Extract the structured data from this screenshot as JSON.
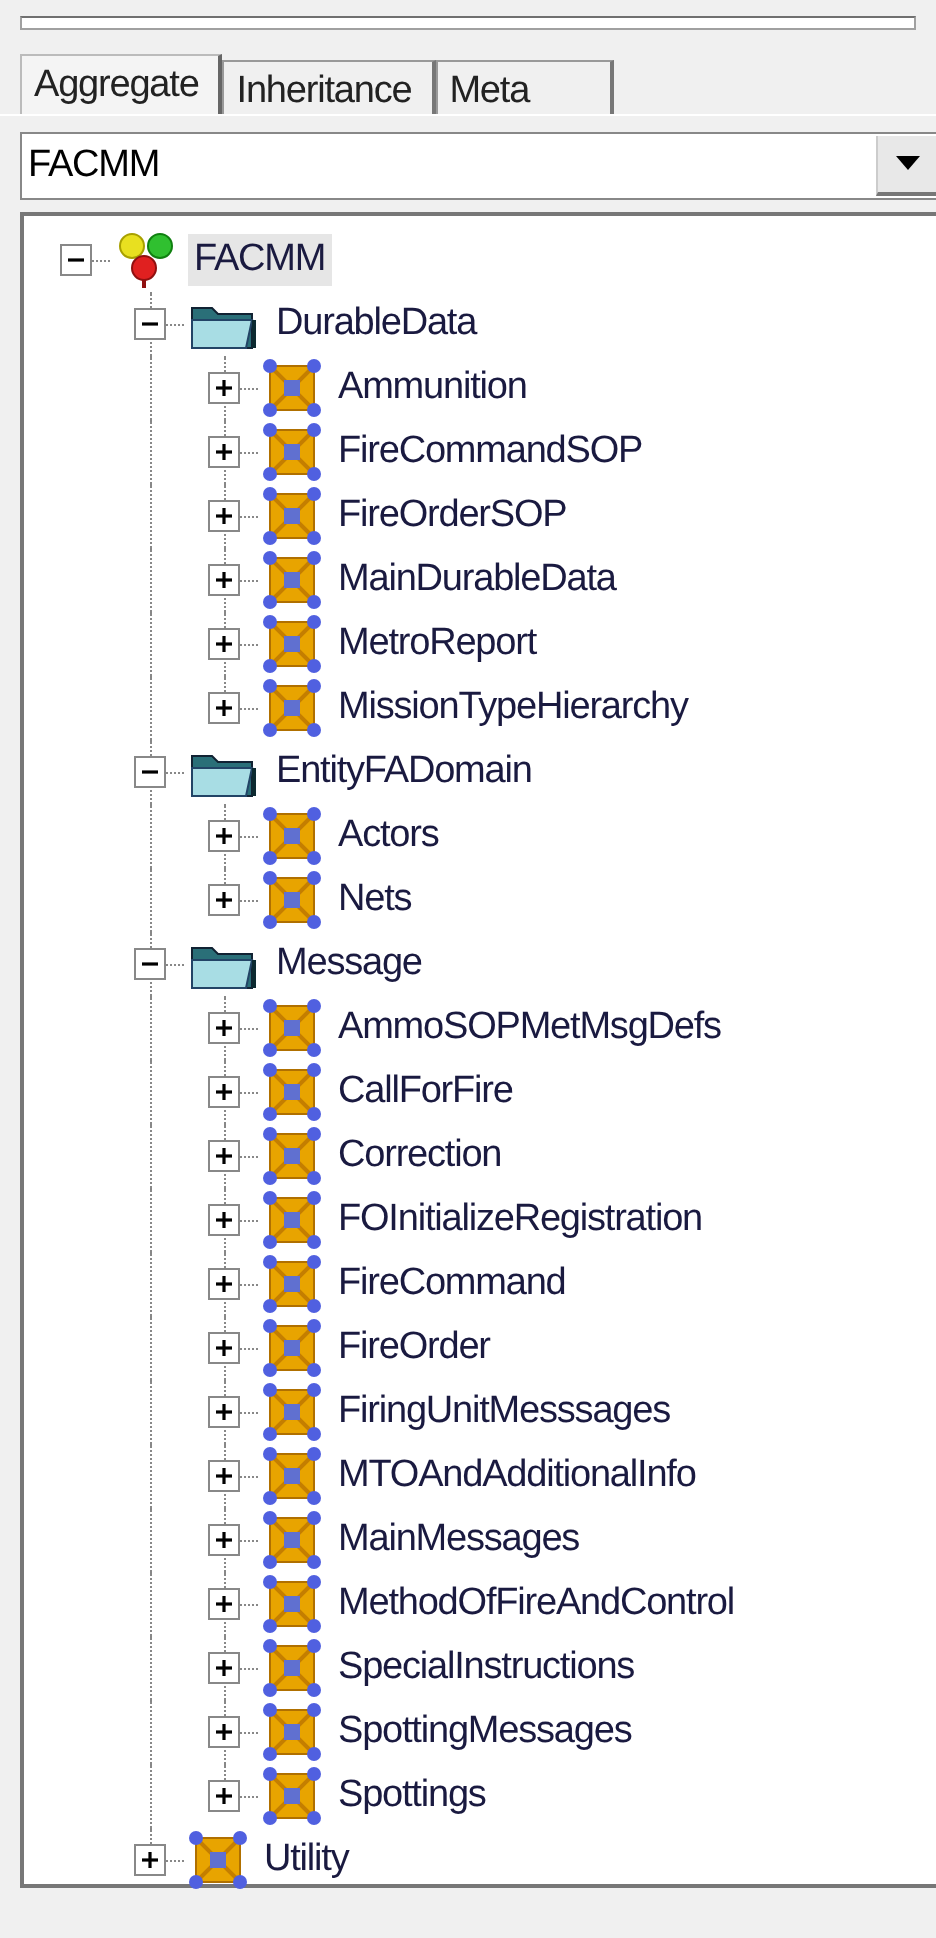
{
  "tabs": [
    {
      "label": "Aggregate",
      "selected": true
    },
    {
      "label": "Inheritance",
      "selected": false
    },
    {
      "label": "Meta",
      "selected": false
    }
  ],
  "model_select": {
    "value": "FACMM"
  },
  "tree": [
    {
      "label": "FACMM",
      "kind": "model",
      "expanded": true,
      "selected": true,
      "children": [
        {
          "label": "DurableData",
          "kind": "folder",
          "expanded": true,
          "selected": false,
          "children": [
            {
              "label": "Ammunition",
              "kind": "class",
              "expanded": false,
              "selected": false
            },
            {
              "label": "FireCommandSOP",
              "kind": "class",
              "expanded": false,
              "selected": false
            },
            {
              "label": "FireOrderSOP",
              "kind": "class",
              "expanded": false,
              "selected": false
            },
            {
              "label": "MainDurableData",
              "kind": "class",
              "expanded": false,
              "selected": false
            },
            {
              "label": "MetroReport",
              "kind": "class",
              "expanded": false,
              "selected": false
            },
            {
              "label": "MissionTypeHierarchy",
              "kind": "class",
              "expanded": false,
              "selected": false
            }
          ]
        },
        {
          "label": "EntityFADomain",
          "kind": "folder",
          "expanded": true,
          "selected": false,
          "children": [
            {
              "label": "Actors",
              "kind": "class",
              "expanded": false,
              "selected": false
            },
            {
              "label": "Nets",
              "kind": "class",
              "expanded": false,
              "selected": false
            }
          ]
        },
        {
          "label": "Message",
          "kind": "folder",
          "expanded": true,
          "selected": false,
          "children": [
            {
              "label": "AmmoSOPMetMsgDefs",
              "kind": "class",
              "expanded": false,
              "selected": false
            },
            {
              "label": "CallForFire",
              "kind": "class",
              "expanded": false,
              "selected": false
            },
            {
              "label": "Correction",
              "kind": "class",
              "expanded": false,
              "selected": false
            },
            {
              "label": "FOInitializeRegistration",
              "kind": "class",
              "expanded": false,
              "selected": false
            },
            {
              "label": "FireCommand",
              "kind": "class",
              "expanded": false,
              "selected": false
            },
            {
              "label": "FireOrder",
              "kind": "class",
              "expanded": false,
              "selected": false
            },
            {
              "label": "FiringUnitMesssages",
              "kind": "class",
              "expanded": false,
              "selected": false
            },
            {
              "label": "MTOAndAdditionalInfo",
              "kind": "class",
              "expanded": false,
              "selected": false
            },
            {
              "label": "MainMessages",
              "kind": "class",
              "expanded": false,
              "selected": false
            },
            {
              "label": "MethodOfFireAndControl",
              "kind": "class",
              "expanded": false,
              "selected": false
            },
            {
              "label": "SpecialInstructions",
              "kind": "class",
              "expanded": false,
              "selected": false
            },
            {
              "label": "SpottingMessages",
              "kind": "class",
              "expanded": false,
              "selected": false
            },
            {
              "label": "Spottings",
              "kind": "class",
              "expanded": false,
              "selected": false
            }
          ]
        },
        {
          "label": "Utility",
          "kind": "class",
          "expanded": false,
          "selected": false
        }
      ]
    }
  ]
}
